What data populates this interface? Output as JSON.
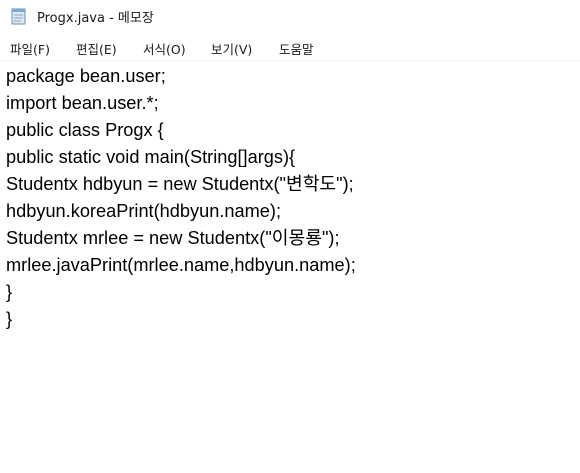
{
  "window": {
    "title": "Progx.java - 메모장",
    "icon": "notepad-icon"
  },
  "menubar": {
    "items": [
      {
        "label": "파일(F)"
      },
      {
        "label": "편집(E)"
      },
      {
        "label": "서식(O)"
      },
      {
        "label": "보기(V)"
      },
      {
        "label": "도움말"
      }
    ]
  },
  "editor": {
    "lines": [
      "package bean.user;",
      "import bean.user.*;",
      "public class Progx {",
      "public static void main(String[]args){",
      "Studentx hdbyun = new Studentx(\"변학도\");",
      "hdbyun.koreaPrint(hdbyun.name);",
      "Studentx mrlee = new Studentx(\"이몽룡\");",
      "mrlee.javaPrint(mrlee.name,hdbyun.name);",
      "}",
      "}"
    ]
  }
}
